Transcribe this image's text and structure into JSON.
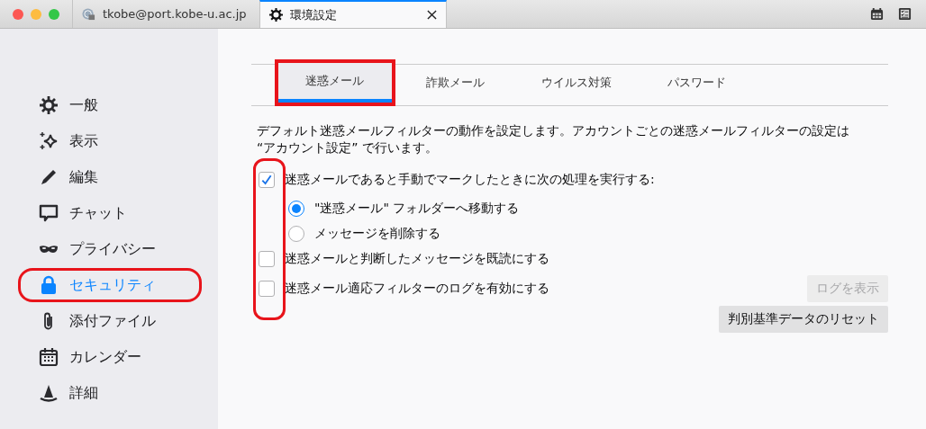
{
  "window": {
    "tabs": [
      {
        "label": "tkobe@port.kobe-u.ac.jp",
        "kind": "mail",
        "selected": false
      },
      {
        "label": "環境設定",
        "kind": "settings",
        "selected": true,
        "closable": true
      }
    ]
  },
  "sidebar": {
    "items": [
      {
        "label": "一般",
        "kind": "gear",
        "selected": false,
        "highlighted": false
      },
      {
        "label": "表示",
        "kind": "sparkle",
        "selected": false,
        "highlighted": false
      },
      {
        "label": "編集",
        "kind": "pencil",
        "selected": false,
        "highlighted": false
      },
      {
        "label": "チャット",
        "kind": "chat",
        "selected": false,
        "highlighted": false
      },
      {
        "label": "プライバシー",
        "kind": "mask",
        "selected": false,
        "highlighted": false
      },
      {
        "label": "セキュリティ",
        "kind": "lock",
        "selected": true,
        "highlighted": true
      },
      {
        "label": "添付ファイル",
        "kind": "paperclip",
        "selected": false,
        "highlighted": false
      },
      {
        "label": "カレンダー",
        "kind": "calendar",
        "selected": false,
        "highlighted": false
      },
      {
        "label": "詳細",
        "kind": "wizard",
        "selected": false,
        "highlighted": false
      }
    ]
  },
  "prefs": {
    "tabs": [
      {
        "label": "迷惑メール",
        "selected": true,
        "highlighted": true
      },
      {
        "label": "詐欺メール",
        "selected": false,
        "highlighted": false
      },
      {
        "label": "ウイルス対策",
        "selected": false,
        "highlighted": false
      },
      {
        "label": "パスワード",
        "selected": false,
        "highlighted": false
      }
    ],
    "description": "デフォルト迷惑メールフィルターの動作を設定します。アカウントごとの迷惑メールフィルターの設定は “アカウント設定” で行います。",
    "checkbox_column_highlighted": true,
    "options": [
      {
        "kind": "checkbox",
        "label": "迷惑メールであると手動でマークしたときに次の処理を実行する:",
        "checked": true
      },
      {
        "kind": "radio",
        "label": "\"迷惑メール\" フォルダーへ移動する",
        "selected": true
      },
      {
        "kind": "radio",
        "label": "メッセージを削除する",
        "selected": false
      },
      {
        "kind": "checkbox",
        "label": "迷惑メールと判断したメッセージを既読にする",
        "checked": false
      },
      {
        "kind": "checkbox",
        "label": "迷惑メール適応フィルターのログを有効にする",
        "checked": false,
        "button": {
          "label": "ログを表示",
          "disabled": true
        }
      }
    ],
    "reset_button": {
      "label": "判別基準データのリセット",
      "disabled": false
    }
  }
}
